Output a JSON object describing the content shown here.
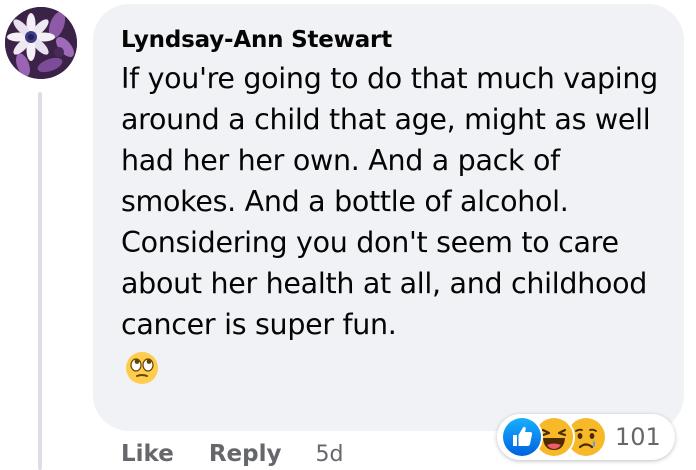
{
  "comment": {
    "author": "Lyndsay-Ann Stewart",
    "text": "If you're going to do that much vaping around a child that age, might as well had her her own. And a pack of smokes. And a bottle of alcohol. Considering you don't seem to care about her health at all, and childhood cancer is super fun.",
    "emoji": "face-with-rolling-eyes-icon"
  },
  "actions": {
    "like_label": "Like",
    "reply_label": "Reply",
    "timestamp": "5d"
  },
  "reactions": {
    "icons": [
      "like-reaction-icon",
      "haha-reaction-icon",
      "sad-reaction-icon"
    ],
    "count": "101"
  },
  "colors": {
    "bubble_background": "#f0f2f5",
    "secondary_text": "#65676b",
    "primary_text": "#050505",
    "like_blue": "#1877f2",
    "reaction_yellow": "#f7b928"
  }
}
